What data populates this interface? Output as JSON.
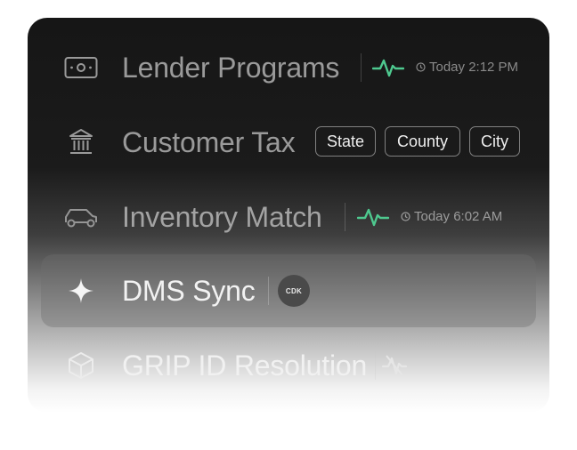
{
  "rows": [
    {
      "label": "Lender Programs",
      "icon": "banknote-icon",
      "status": "active",
      "time": "Today 2:12 PM"
    },
    {
      "label": "Customer Tax",
      "icon": "bank-icon",
      "tags": [
        "State",
        "County",
        "City"
      ]
    },
    {
      "label": "Inventory Match",
      "icon": "car-icon",
      "status": "active",
      "time": "Today 6:02 AM"
    },
    {
      "label": "DMS Sync",
      "icon": "sparkle-icon",
      "badge": "CDK",
      "selected": true
    },
    {
      "label": "GRIP ID Resolution",
      "icon": "cube-icon",
      "status": "inactive"
    }
  ],
  "colors": {
    "pulse": "#4ec98f",
    "text_dim": "#8c8c8c",
    "text_bright": "#f2f2f2"
  }
}
